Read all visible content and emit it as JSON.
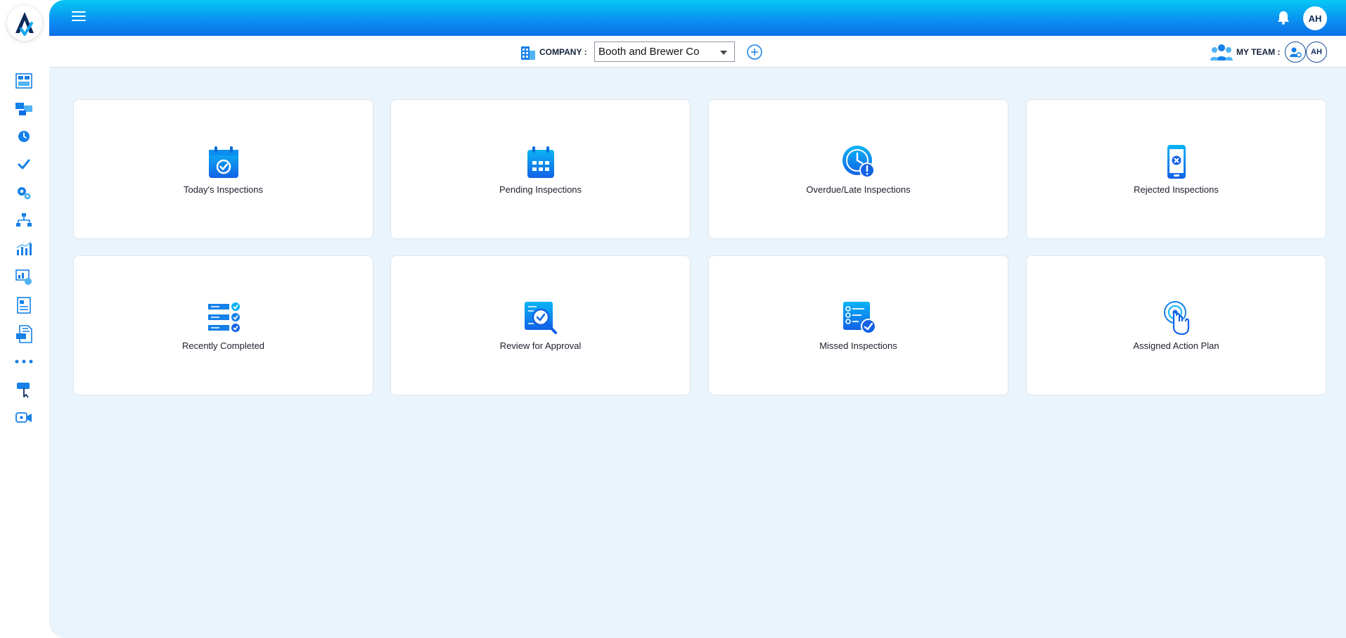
{
  "rail": {
    "items": [
      {
        "name": "dashboard-grid-icon"
      },
      {
        "name": "computers-icon"
      },
      {
        "name": "clock-icon"
      },
      {
        "name": "checkmark-icon"
      },
      {
        "name": "settings-gears-icon"
      },
      {
        "name": "hierarchy-icon"
      },
      {
        "name": "bar-chart-icon"
      },
      {
        "name": "analytics-icon"
      },
      {
        "name": "document-icon"
      },
      {
        "name": "log-file-icon"
      },
      {
        "name": "more-dots-icon"
      },
      {
        "name": "buy-icon"
      },
      {
        "name": "help-video-icon"
      }
    ]
  },
  "topbar": {
    "user_initials": "AH"
  },
  "subbar": {
    "company_label": "COMPANY :",
    "company_value": "Booth and Brewer Co",
    "team_label": "MY TEAM :",
    "team_member_initials": "AH"
  },
  "cards": [
    {
      "label": "Today's Inspections",
      "icon": "calendar-check-icon"
    },
    {
      "label": "Pending Inspections",
      "icon": "calendar-grid-icon"
    },
    {
      "label": "Overdue/Late Inspections",
      "icon": "clock-alert-icon"
    },
    {
      "label": "Rejected Inspections",
      "icon": "phone-reject-icon"
    },
    {
      "label": "Recently Completed",
      "icon": "checklist-icon"
    },
    {
      "label": "Review for Approval",
      "icon": "magnifier-check-icon"
    },
    {
      "label": "Missed Inspections",
      "icon": "checklist-missed-icon"
    },
    {
      "label": "Assigned Action Plan",
      "icon": "touch-target-icon"
    }
  ],
  "colors": {
    "accent": "#0a8df0",
    "icon_blue": "#1580e8",
    "background": "#e9f4fc"
  }
}
